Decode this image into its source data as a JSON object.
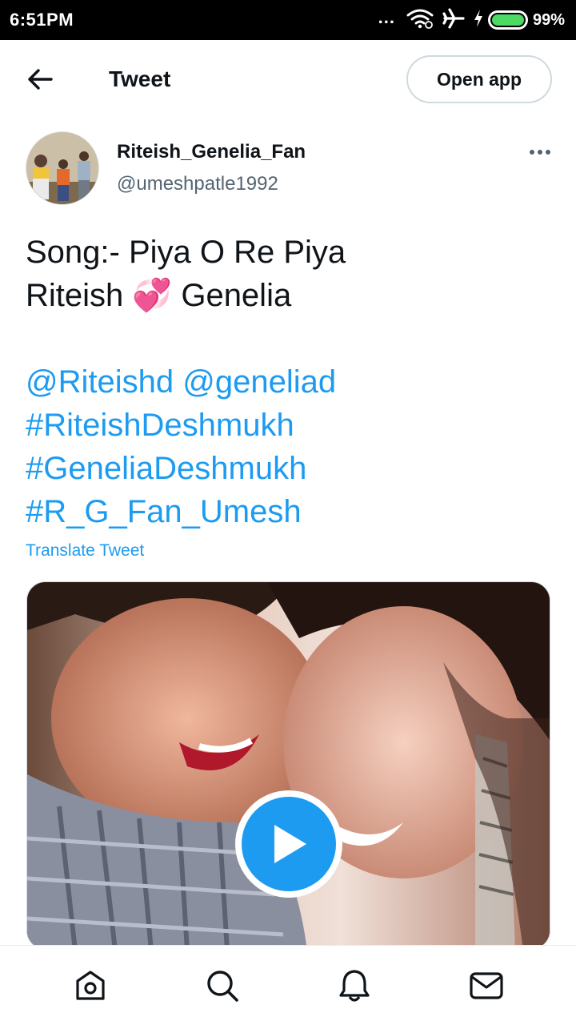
{
  "status_bar": {
    "time": "6:51PM",
    "dots": "...",
    "battery": "99%",
    "battery_level": 0.99,
    "icons": [
      "wifi-icon",
      "airplane-icon",
      "charging-icon",
      "battery-icon"
    ]
  },
  "header": {
    "title": "Tweet",
    "open_app": "Open app",
    "back_icon": "arrow-left-icon"
  },
  "tweet": {
    "author_name": "Riteish_Genelia_Fan",
    "author_handle": "@umeshpatle1992",
    "text_line1": "Song:- Piya O Re Piya",
    "text_line2_a": "Riteish",
    "text_line2_emoji": "💞",
    "text_line2_b": "Genelia",
    "mention1": "@Riteishd",
    "mention2": "@geneliad",
    "hashtag1": "#RiteishDeshmukh",
    "hashtag2": "#GeneliaDeshmukh",
    "hashtag3": "#R_G_Fan_Umesh",
    "translate": "Translate Tweet"
  },
  "media": {
    "type": "video",
    "play_icon": "play-icon"
  },
  "bottom_nav": {
    "items": [
      "home-icon",
      "search-icon",
      "notifications-icon",
      "messages-icon"
    ]
  },
  "colors": {
    "accent": "#1d9bf0",
    "text": "#0f1419",
    "secondary": "#536471",
    "border": "#cfd9de"
  }
}
